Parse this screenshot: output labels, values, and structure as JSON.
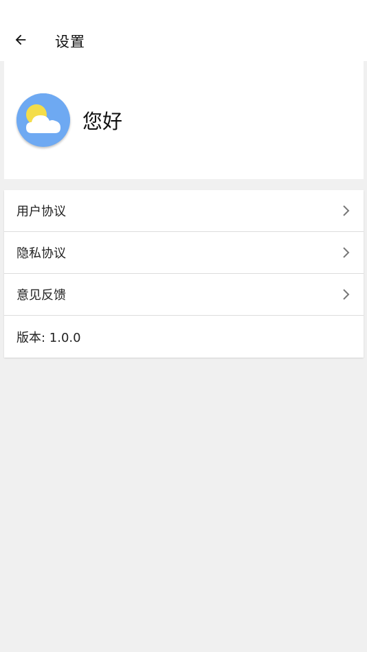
{
  "app_bar": {
    "back_icon": "arrow-left-icon",
    "title": "设置"
  },
  "profile": {
    "avatar_icon": "weather-cloud-sun-icon",
    "greeting": "您好"
  },
  "menu": {
    "items": [
      {
        "label": "用户协议",
        "icon": "chevron-right-icon"
      },
      {
        "label": "隐私协议",
        "icon": "chevron-right-icon"
      },
      {
        "label": "意见反馈",
        "icon": "chevron-right-icon"
      }
    ],
    "version_label": "版本: 1.0.0"
  },
  "colors": {
    "background": "#f0f0f0",
    "card": "#ffffff",
    "avatar_blue": "#6ea9f2",
    "sun_yellow": "#f4dd4a",
    "chevron_gray": "#777777"
  }
}
